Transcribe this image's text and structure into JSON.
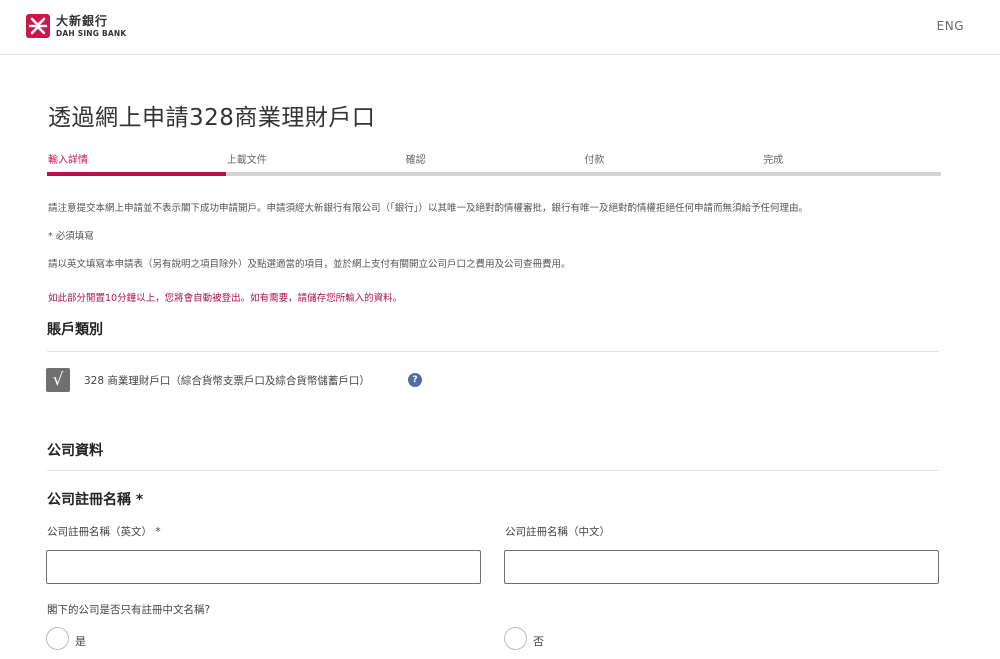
{
  "header": {
    "logo_cn": "大新銀行",
    "logo_en": "DAH SING BANK",
    "language": "ENG"
  },
  "page_title": "透過網上申請328商業理財戶口",
  "steps": [
    {
      "label": "輸入詳情",
      "active": true
    },
    {
      "label": "上載文件",
      "active": false
    },
    {
      "label": "確認",
      "active": false
    },
    {
      "label": "付款",
      "active": false
    },
    {
      "label": "完成",
      "active": false
    }
  ],
  "notes": {
    "disclaimer": "請注意提交本網上申請並不表示閣下成功申請開戶。申請須經大新銀行有限公司（「銀行」）以其唯一及絕對酌情權審批，銀行有唯一及絕對酌情權拒絕任何申請而無須給予任何理由。",
    "required": "* 必須填寫",
    "instruction": "請以英文填寫本申請表（另有說明之項目除外）及點選適當的項目，並於網上支付有關開立公司戶口之費用及公司查冊費用。",
    "timeout_warning": "如此部分閒置10分鐘以上，您將會自動被登出。如有需要，請儲存您所輸入的資料。"
  },
  "account_type": {
    "heading": "賬戶類別",
    "checked": true,
    "check_mark": "√",
    "option_label": "328 商業理財戶口（綜合貨幣支票戶口及綜合貨幣儲蓄戶口）",
    "help": "?"
  },
  "company_info": {
    "heading": "公司資料",
    "reg_name_heading": "公司註冊名稱 *",
    "name_en_label": "公司註冊名稱（英文） *",
    "name_en_value": "",
    "name_cn_label": "公司註冊名稱（中文）",
    "name_cn_value": "",
    "cn_only_question": "閣下的公司是否只有註冊中文名稱?",
    "yes_label": "是",
    "no_label": "否"
  },
  "colors": {
    "brand": "#b3124a",
    "step_inactive": "#d4d4d4",
    "checkbox": "#707070",
    "help_icon": "#4c6ea5"
  }
}
